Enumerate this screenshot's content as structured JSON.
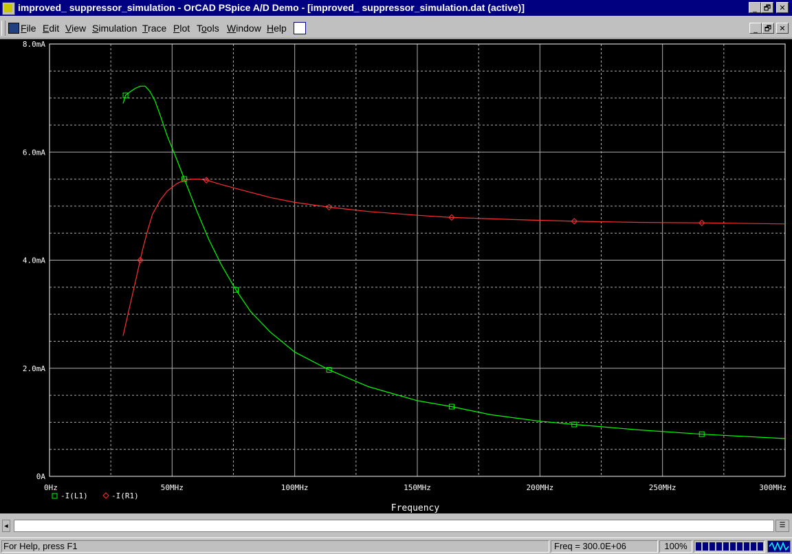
{
  "window": {
    "title": "improved_ suppressor_simulation - OrCAD PSpice A/D Demo  - [improved_ suppressor_simulation.dat (active)]",
    "minimize": "_",
    "restore": "🗗",
    "close": "✕"
  },
  "menu": {
    "items": [
      {
        "label": "File",
        "accel": "F"
      },
      {
        "label": "Edit",
        "accel": "E"
      },
      {
        "label": "View",
        "accel": "V"
      },
      {
        "label": "Simulation",
        "accel": "S"
      },
      {
        "label": "Trace",
        "accel": "T"
      },
      {
        "label": "Plot",
        "accel": "P"
      },
      {
        "label": "Tools",
        "accel": "o"
      },
      {
        "label": "Window",
        "accel": "W"
      },
      {
        "label": "Help",
        "accel": "H"
      }
    ]
  },
  "chart_data": {
    "type": "line",
    "xlabel": "Frequency",
    "xlim": [
      0,
      300
    ],
    "ylim": [
      0,
      8
    ],
    "x_ticks": [
      "0Hz",
      "50MHz",
      "100MHz",
      "150MHz",
      "200MHz",
      "250MHz",
      "300MHz"
    ],
    "y_ticks": [
      "0A",
      "2.0mA",
      "4.0mA",
      "6.0mA",
      "8.0mA"
    ],
    "grid": true,
    "legend_position": "bottom-left",
    "background": "#000000",
    "series": [
      {
        "name": "-I(L1)",
        "color": "#00ff00",
        "marker": "square",
        "x": [
          30,
          31,
          33,
          35,
          37,
          39,
          41,
          43,
          45,
          48,
          52,
          55,
          60,
          65,
          70,
          76,
          82,
          90,
          100,
          114,
          130,
          150,
          164,
          180,
          200,
          214,
          240,
          266,
          300
        ],
        "y": [
          6.9,
          7.05,
          7.12,
          7.18,
          7.22,
          7.22,
          7.12,
          6.95,
          6.7,
          6.3,
          5.85,
          5.5,
          4.92,
          4.38,
          3.92,
          3.45,
          3.05,
          2.67,
          2.3,
          1.97,
          1.66,
          1.4,
          1.29,
          1.14,
          1.02,
          0.96,
          0.86,
          0.78,
          0.7
        ],
        "markers_x": [
          31,
          55,
          76,
          114,
          164,
          214,
          266
        ]
      },
      {
        "name": "-I(R1)",
        "color": "#ff3030",
        "marker": "diamond",
        "x": [
          30,
          32,
          34,
          36,
          38,
          40,
          42,
          45,
          48,
          52,
          55,
          58,
          61,
          64,
          70,
          80,
          90,
          100,
          114,
          130,
          150,
          164,
          190,
          214,
          240,
          266,
          300
        ],
        "y": [
          2.6,
          3.0,
          3.4,
          3.8,
          4.2,
          4.55,
          4.85,
          5.1,
          5.28,
          5.42,
          5.48,
          5.5,
          5.5,
          5.48,
          5.4,
          5.28,
          5.16,
          5.07,
          4.98,
          4.9,
          4.83,
          4.79,
          4.75,
          4.72,
          4.7,
          4.69,
          4.67
        ],
        "markers_x": [
          37,
          64,
          114,
          164,
          214,
          266
        ]
      }
    ]
  },
  "command_line": {
    "value": ""
  },
  "status": {
    "help": "For Help, press F1",
    "freq": "Freq =  300.0E+06",
    "zoom": "100%",
    "progress": 1.0
  }
}
